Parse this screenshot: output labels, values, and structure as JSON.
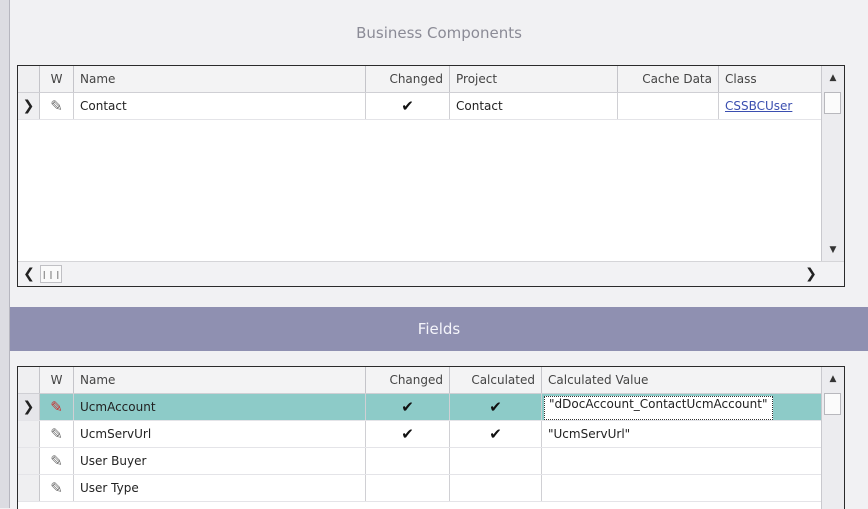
{
  "business_components": {
    "title": "Business Components",
    "columns": [
      "W",
      "Name",
      "Changed",
      "Project",
      "Cache Data",
      "Class"
    ],
    "rows": [
      {
        "name": "Contact",
        "changed": "✔",
        "project": "Contact",
        "cache_data": "",
        "class": "CSSBCUser"
      }
    ]
  },
  "fields": {
    "title": "Fields",
    "columns": [
      "W",
      "Name",
      "Changed",
      "Calculated",
      "Calculated Value"
    ],
    "rows": [
      {
        "name": "UcmAccount",
        "changed": "✔",
        "calculated": "✔",
        "calculated_value": "\"dDocAccount_ContactUcmAccount\""
      },
      {
        "name": "UcmServUrl",
        "changed": "✔",
        "calculated": "✔",
        "calculated_value": "\"UcmServUrl\""
      },
      {
        "name": "User Buyer",
        "changed": "",
        "calculated": "",
        "calculated_value": ""
      },
      {
        "name": "User Type",
        "changed": "",
        "calculated": "",
        "calculated_value": ""
      }
    ]
  },
  "icons": {
    "row_selector": "chevron-right-icon",
    "edit": "pencil-icon",
    "check": "checkmark-icon",
    "scroll_up": "triangle-up-icon",
    "scroll_down": "triangle-down-icon",
    "scroll_left": "chevron-left-icon",
    "scroll_right": "chevron-right-icon"
  },
  "colors": {
    "fields_header": "#8f90b1",
    "active_row": "#8dcbc8",
    "link": "#3b4fb0"
  }
}
